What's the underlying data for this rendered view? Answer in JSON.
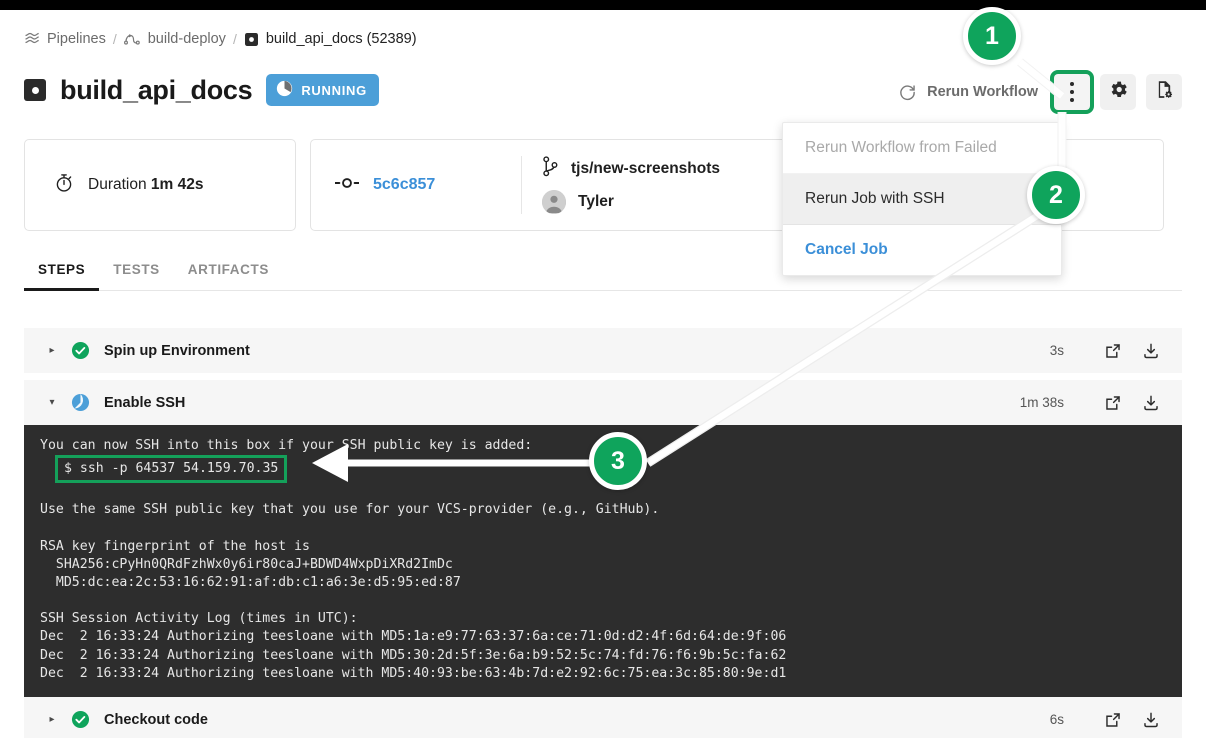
{
  "theme": {
    "accent_green": "#0FA45C",
    "highlight_green": "#14A05A",
    "link_blue": "#3B8FD8",
    "running_blue": "#4C9FD8",
    "terminal_bg": "#2d2d2d"
  },
  "breadcrumb": {
    "items": [
      {
        "label": "Pipelines",
        "icon": "pipelines-icon"
      },
      {
        "label": "build-deploy",
        "icon": "workflow-icon"
      },
      {
        "label": "build_api_docs (52389)",
        "icon": "job-square-icon"
      }
    ],
    "separator": "/"
  },
  "header": {
    "title": "build_api_docs",
    "status_badge": "RUNNING",
    "rerun_workflow_label": "Rerun Workflow",
    "buttons": {
      "kebab": "kebab-menu-button",
      "gear": "settings-button",
      "config": "job-config-button"
    }
  },
  "dropdown": {
    "items": [
      {
        "label": "Rerun Workflow from Failed",
        "state": "disabled"
      },
      {
        "label": "Rerun Job with SSH",
        "state": "highlighted"
      },
      {
        "label": "Cancel Job",
        "state": "link"
      }
    ]
  },
  "cards": {
    "duration": {
      "label": "Duration",
      "value": "1m 42s"
    },
    "commit": {
      "hash": "5c6c857",
      "branch": "tjs/new-screenshots",
      "author": "Tyler"
    }
  },
  "tabs": [
    {
      "label": "STEPS",
      "active": true
    },
    {
      "label": "TESTS",
      "active": false
    },
    {
      "label": "ARTIFACTS",
      "active": false
    }
  ],
  "steps": [
    {
      "name": "Spin up Environment",
      "status": "success",
      "duration": "3s",
      "expanded": false,
      "caret": "▸"
    },
    {
      "name": "Enable SSH",
      "status": "running",
      "duration": "1m 38s",
      "expanded": true,
      "caret": "▾"
    },
    {
      "name": "Checkout code",
      "status": "success",
      "duration": "6s",
      "expanded": false,
      "caret": "▸"
    }
  ],
  "terminal": {
    "line_intro": "You can now SSH into this box if your SSH public key is added:",
    "ssh_command": "$ ssh -p 64537 54.159.70.35",
    "line_vcs": "Use the same SSH public key that you use for your VCS-provider (e.g., GitHub).",
    "line_rsa_title": "RSA key fingerprint of the host is",
    "line_sha256": "  SHA256:cPyHn0QRdFzhWx0y6ir80caJ+BDWD4WxpDiXRd2ImDc",
    "line_md5": "  MD5:dc:ea:2c:53:16:62:91:af:db:c1:a6:3e:d5:95:ed:87",
    "line_log_title": "SSH Session Activity Log (times in UTC):",
    "log_lines": [
      "Dec  2 16:33:24 Authorizing teesloane with MD5:1a:e9:77:63:37:6a:ce:71:0d:d2:4f:6d:64:de:9f:06",
      "Dec  2 16:33:24 Authorizing teesloane with MD5:30:2d:5f:3e:6a:b9:52:5c:74:fd:76:f6:9b:5c:fa:62",
      "Dec  2 16:33:24 Authorizing teesloane with MD5:40:93:be:63:4b:7d:e2:92:6c:75:ea:3c:85:80:9e:d1"
    ]
  },
  "callouts": [
    {
      "number": "1",
      "target": "kebab-menu-button"
    },
    {
      "number": "2",
      "target": "rerun-job-with-ssh-menu-item"
    },
    {
      "number": "3",
      "target": "ssh-command-highlight"
    }
  ]
}
